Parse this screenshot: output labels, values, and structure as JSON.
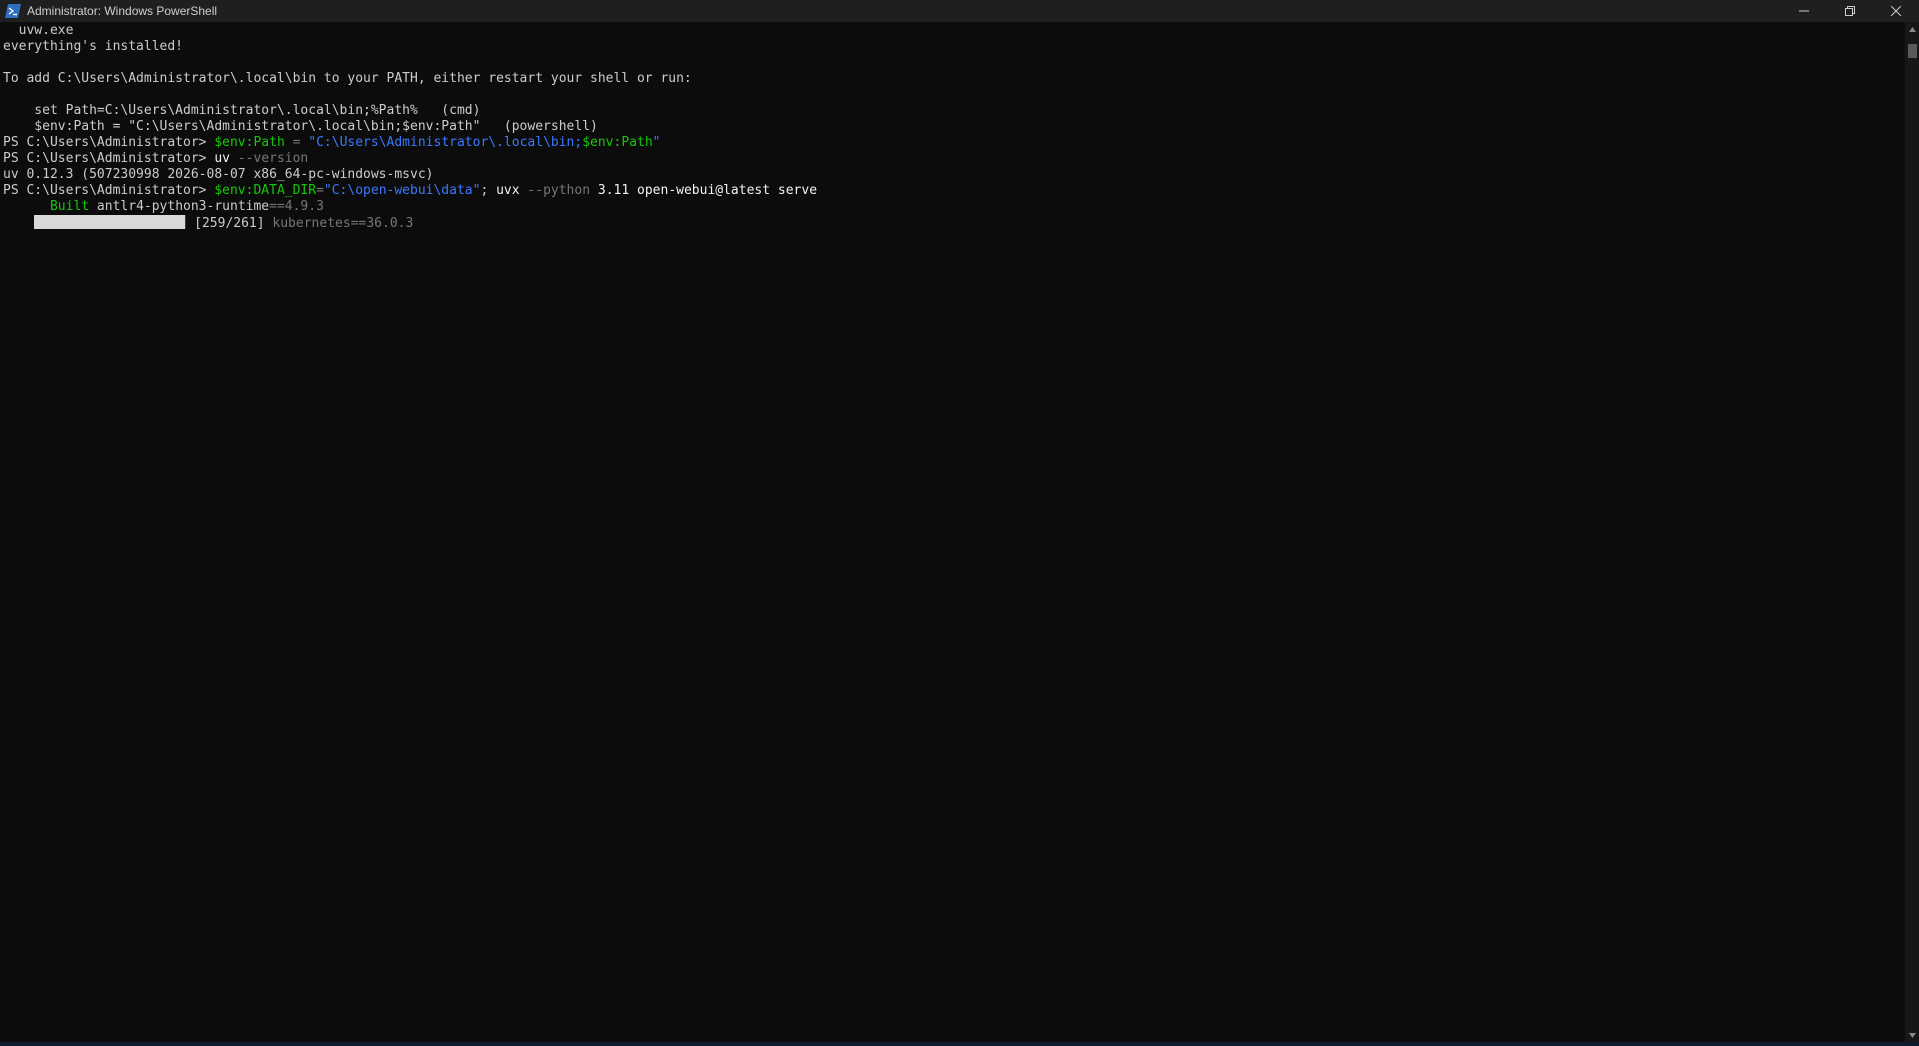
{
  "window": {
    "title": "Administrator: Windows PowerShell",
    "icon": "powershell-icon",
    "controls": [
      "minimize-icon",
      "restore-icon",
      "close-icon"
    ]
  },
  "colors": {
    "background": "#0c0c0c",
    "text": "#cccccc",
    "command": "#f9f1a5",
    "variable": "#16c60c",
    "string": "#61d6d6",
    "parameter": "#767676"
  },
  "terminal": {
    "lines": [
      [
        {
          "t": "  uvw.exe",
          "c": "default"
        }
      ],
      [
        {
          "t": "everything's installed!",
          "c": "default"
        }
      ],
      [
        {
          "t": "",
          "c": "default"
        }
      ],
      [
        {
          "t": "To add C:\\Users\\Administrator\\.local\\bin to your PATH, either restart your shell or run:",
          "c": "default"
        }
      ],
      [
        {
          "t": "",
          "c": "default"
        }
      ],
      [
        {
          "t": "    set Path=C:\\Users\\Administrator\\.local\\bin;%Path%   (cmd)",
          "c": "default"
        }
      ],
      [
        {
          "t": "    $env:Path = \"C:\\Users\\Administrator\\.local\\bin;$env:Path\"   (powershell)",
          "c": "default"
        }
      ],
      [
        {
          "t": "PS C:\\Users\\Administrator> ",
          "c": "default"
        },
        {
          "t": "$env:Path",
          "c": "green"
        },
        {
          "t": " = ",
          "c": "gray"
        },
        {
          "t": "\"C:\\Users\\Administrator\\.local\\bin;",
          "c": "blue"
        },
        {
          "t": "$env:Path",
          "c": "green"
        },
        {
          "t": "\"",
          "c": "blue"
        }
      ],
      [
        {
          "t": "PS C:\\Users\\Administrator> ",
          "c": "default"
        },
        {
          "t": "uv",
          "c": "white"
        },
        {
          "t": " --version",
          "c": "gray"
        }
      ],
      [
        {
          "t": "uv 0.12.3 (507230998 2026-08-07 x86_64-pc-windows-msvc)",
          "c": "default"
        }
      ],
      [
        {
          "t": "PS C:\\Users\\Administrator> ",
          "c": "default"
        },
        {
          "t": "$env:DATA_DIR",
          "c": "green"
        },
        {
          "t": "=",
          "c": "gray"
        },
        {
          "t": "\"C:\\open-webui\\data\"",
          "c": "blue"
        },
        {
          "t": "; ",
          "c": "default"
        },
        {
          "t": "uvx",
          "c": "white"
        },
        {
          "t": " --python",
          "c": "gray"
        },
        {
          "t": " 3.11 open-webui@latest serve",
          "c": "white"
        }
      ],
      [
        {
          "t": "      ",
          "c": "default"
        },
        {
          "t": "Built",
          "c": "green"
        },
        {
          "t": " antlr4-python3-runtime",
          "c": "default"
        },
        {
          "t": "==4.9.3",
          "c": "gray"
        }
      ]
    ],
    "progress": {
      "fraction": 0.993,
      "counter": " [259/261] ",
      "package_name": "kubernetes",
      "package_version": "==36.0.3"
    }
  }
}
